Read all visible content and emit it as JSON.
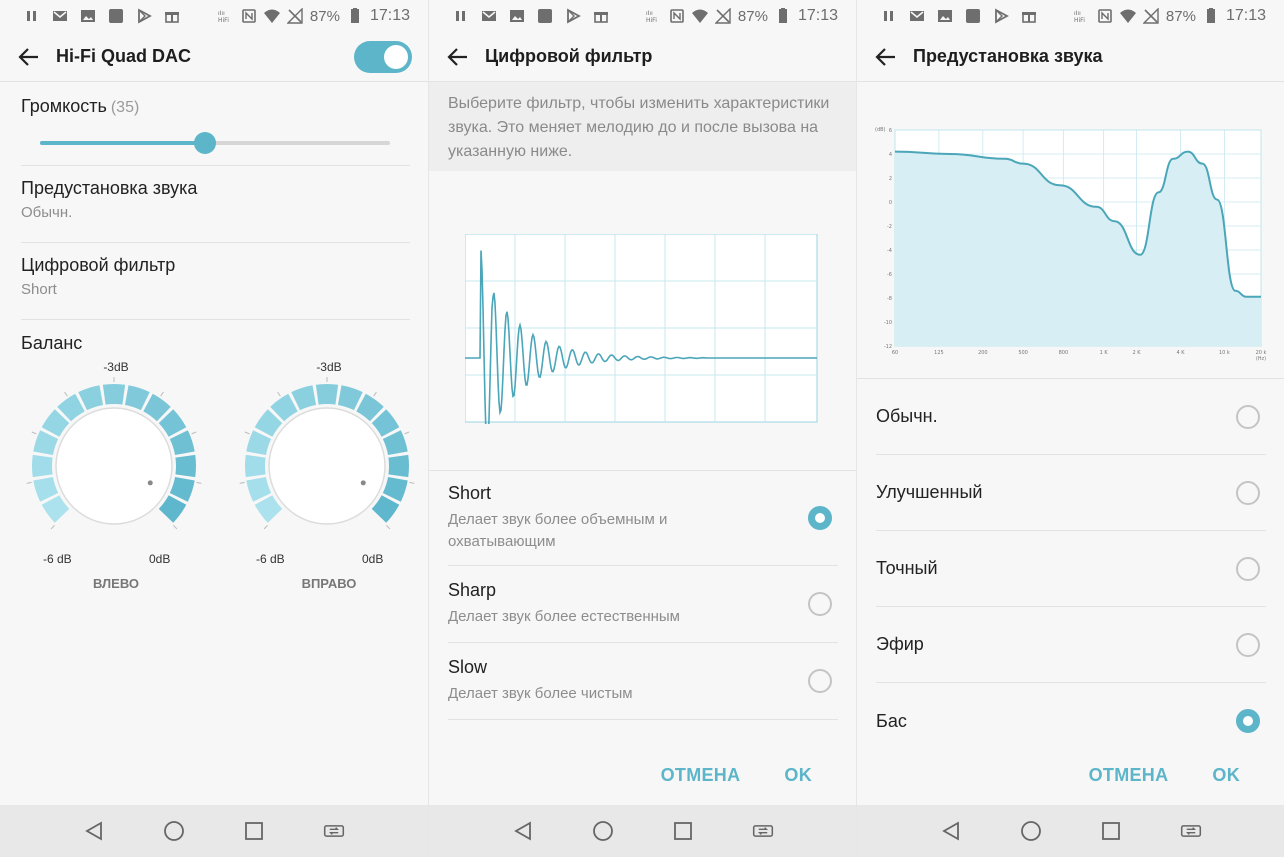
{
  "status_bar": {
    "battery_percent": "87%",
    "time": "17:13",
    "icons": [
      "pause-icon",
      "gmail-icon",
      "image-icon",
      "app-icon",
      "play-store-icon",
      "gift-icon",
      "hifi-icon",
      "nfc-icon",
      "wifi-icon",
      "no-signal-icon",
      "battery-icon"
    ]
  },
  "accent_color": "#5cb5c9",
  "screen1": {
    "title": "Hi-Fi Quad DAC",
    "toggle_on": true,
    "volume": {
      "label": "Громкость",
      "value": "(35)",
      "level_fraction": 0.47
    },
    "sound_preset": {
      "title": "Предустановка звука",
      "value": "Обычн."
    },
    "digital_filter": {
      "title": "Цифровой фильтр",
      "value": "Short"
    },
    "balance": {
      "title": "Баланс",
      "left": {
        "top": "-3dB",
        "min": "-6 dB",
        "max": "0dB",
        "name": "ВЛЕВО"
      },
      "right": {
        "top": "-3dB",
        "min": "-6 dB",
        "max": "0dB",
        "name": "ВПРАВО"
      }
    }
  },
  "screen2": {
    "title": "Цифровой фильтр",
    "description": "Выберите фильтр, чтобы изменить характеристики звука. Это меняет мелодию до и после вызова на указанную ниже.",
    "options": [
      {
        "title": "Short",
        "subtitle": "Делает звук более объемным и охватывающим",
        "selected": true
      },
      {
        "title": "Sharp",
        "subtitle": "Делает звук более естественным",
        "selected": false
      },
      {
        "title": "Slow",
        "subtitle": "Делает звук более чистым",
        "selected": false
      }
    ],
    "cancel": "ОТМЕНА",
    "ok": "OK"
  },
  "screen3": {
    "title": "Предустановка звука",
    "eq_chart": {
      "y_unit": "(dB)",
      "y_ticks": [
        "6",
        "4",
        "2",
        "0",
        "-2",
        "-4",
        "-6",
        "-8",
        "-10",
        "-12"
      ],
      "x_ticks": [
        "60",
        "125",
        "200",
        "500",
        "800",
        "1 K",
        "2 K",
        "4 K",
        "10 k",
        "20 k"
      ],
      "x_unit": "(Hz)"
    },
    "presets": [
      {
        "name": "Обычн.",
        "selected": false
      },
      {
        "name": "Улучшенный",
        "selected": false
      },
      {
        "name": "Точный",
        "selected": false
      },
      {
        "name": "Эфир",
        "selected": false
      },
      {
        "name": "Бас",
        "selected": true
      }
    ],
    "cancel": "ОТМЕНА",
    "ok": "OK"
  }
}
